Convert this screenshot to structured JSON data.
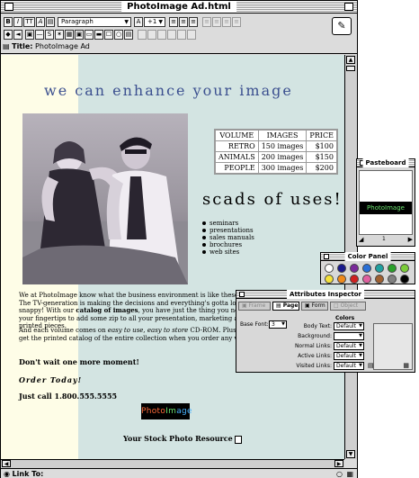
{
  "window": {
    "title": "PhotoImage Ad.html"
  },
  "toolbar": {
    "bold": "B",
    "italic": "I",
    "teletype": "TT",
    "font_a": "A",
    "paragraph_select": "Paragraph",
    "size_decrease": "A",
    "size_select": "+1",
    "page_title_label": "Title:",
    "page_title_value": "PhotoImage Ad"
  },
  "doc": {
    "headline": "we can enhance your image",
    "table": {
      "headers": [
        "VOLUME",
        "IMAGES",
        "PRICE"
      ],
      "rows": [
        [
          "RETRO",
          "150 images",
          "$100"
        ],
        [
          "ANIMALS",
          "200 images",
          "$150"
        ],
        [
          "PEOPLE",
          "300 images",
          "$200"
        ]
      ]
    },
    "scads": "scads of uses!",
    "bullets": [
      "seminars",
      "presentations",
      "sales manuals",
      "brochures",
      "web sites"
    ],
    "para1_a": "We at PhotoImage know what the business environment is like these days. The TV-generation is making the decisions and everything's gotta look snappy! With our ",
    "para1_bold": "catalog of images",
    "para1_b": ", you have just the thing you need at your fingertips to add some zip to all your presentation, marketing and printed pieces.",
    "para2_a": "And each volume comes on ",
    "para2_em": "easy to use, easy to store",
    "para2_b": " CD-ROM. Plus, you get the printed catalog of the entire collection when you order any volume.",
    "cta1": "Don't wait one more moment!",
    "cta2": "Order Today!",
    "cta3": "Just call 1.800.555.5555",
    "logo": [
      "Photo",
      "Im",
      "age"
    ],
    "stock_line": "Your Stock Photo Resource"
  },
  "status": {
    "link_label": "Link To:"
  },
  "pasteboard": {
    "title": "Pasteboard",
    "logo": "PhotoImage",
    "page_num": "1"
  },
  "color_panel": {
    "title": "Color Panel",
    "swatches_row1": [
      "#ffffff",
      "#1a1a8c",
      "#7a2a9a",
      "#2a6fd6",
      "#20a0a0",
      "#2aa02a",
      "#7ccc3a"
    ],
    "swatches_row2": [
      "#f5e23a",
      "#f08a1a",
      "#d02020",
      "#e060a0",
      "#a06030",
      "#808080",
      "#000000"
    ]
  },
  "attributes": {
    "title": "Attributes Inspector",
    "tabs": [
      "Frame",
      "Page",
      "Form",
      "Object"
    ],
    "base_font_label": "Base Font:",
    "base_font_value": "3",
    "colors_heading": "Colors",
    "fields": [
      {
        "label": "Body Text:",
        "value": "Default"
      },
      {
        "label": "Background:",
        "value": ""
      },
      {
        "label": "Normal Links:",
        "value": "Default"
      },
      {
        "label": "Active Links:",
        "value": "Default"
      },
      {
        "label": "Visited Links:",
        "value": "Default"
      }
    ]
  }
}
